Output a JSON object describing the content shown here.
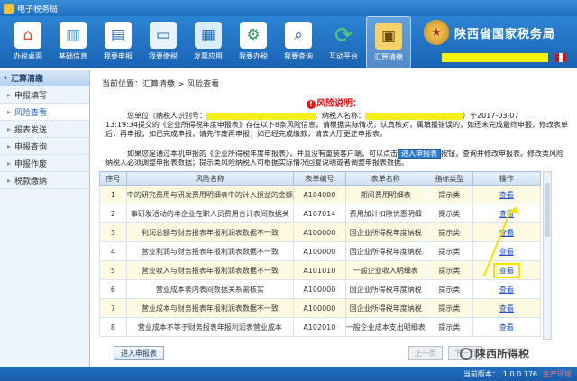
{
  "window": {
    "title": "电子税务局"
  },
  "toolbar": {
    "items": [
      {
        "label": "办税桌面",
        "icon": "home-icon",
        "color": "#e84a2a"
      },
      {
        "label": "基础信息",
        "icon": "chart-icon",
        "color": "#3aa0e8"
      },
      {
        "label": "我要申报",
        "icon": "form-icon",
        "color": "#ffffff"
      },
      {
        "label": "我要缴税",
        "icon": "tax-card-icon",
        "color": "#6bc0f0"
      },
      {
        "label": "发票应用",
        "icon": "invoice-icon",
        "color": "#59b7ea"
      },
      {
        "label": "我要办税",
        "icon": "gear-icon",
        "color": "#2aa05a"
      },
      {
        "label": "我要查询",
        "icon": "search-icon",
        "color": "#ffffff"
      },
      {
        "label": "互动平台",
        "icon": "refresh-icon",
        "color": "#4fd16a"
      },
      {
        "label": "汇算清缴",
        "icon": "settlement-icon",
        "color": "#f6d36a",
        "active": true
      }
    ],
    "brand": "陕西省国家税务局"
  },
  "sidebar": {
    "header": "汇算清缴",
    "items": [
      {
        "label": "申报填写",
        "active": false
      },
      {
        "label": "风险查看",
        "active": true
      },
      {
        "label": "报表发送",
        "active": false
      },
      {
        "label": "申报查询",
        "active": false
      },
      {
        "label": "申报作废",
        "active": false
      },
      {
        "label": "税款缴纳",
        "active": false
      }
    ]
  },
  "main": {
    "breadcrumb": "当前位置：汇算清缴 > 风险查看",
    "notice_title": "风险说明：",
    "para1_a": "您单位（纳税人识别号：",
    "para1_b": "，纳税人名称：",
    "para1_c": "）于2017-03-07",
    "para1_d": "13:19:34提交的《企业所得税年度申报表》存在以下8条风险信息，请根据实际情况，认真核对，属填报错误的，如还未完成最终申报，修改表单后，再申报；如已完成申报，请先作废再申报；如已经完成缴款，请去大厅更正申报表。",
    "para2_a": "如果您是通过本机申报的《企业所得税年度申报表》，并且没有重装客户端，可以点击",
    "para2_btn": "进入申报表",
    "para2_b": "按钮，查询并修改申报表。修改类风险纳税人必须调整申报表数据；提示类风险纳税人可根据实际情况回复说明或者调整申报表数据。",
    "columns": [
      "序号",
      "风险名称",
      "表单编号",
      "表单名称",
      "指标类型",
      "操作"
    ],
    "rows": [
      {
        "no": "1",
        "name": "中的研究费用与研发费用明细表中的计入损益的金额",
        "code": "A104000",
        "form": "期间费用明细表",
        "type": "提示类",
        "op": "查看"
      },
      {
        "no": "2",
        "name": "事研发活动的本企业在职人员费用合计表间数据关",
        "code": "A107014",
        "form": "费用加计扣除优惠明细",
        "type": "提示类",
        "op": "查看"
      },
      {
        "no": "3",
        "name": "利润总额与财务报表年报利润表数据不一致",
        "code": "A100000",
        "form": "国企业所得税年度纳税",
        "type": "提示类",
        "op": "查看"
      },
      {
        "no": "4",
        "name": "营业利润与财务报表年报利润表数据不一致",
        "code": "A100000",
        "form": "国企业所得税年度纳税",
        "type": "提示类",
        "op": "查看"
      },
      {
        "no": "5",
        "name": "营业收入与财务报表年报利润表数据不一致",
        "code": "A101010",
        "form": "一般企业收入明细表",
        "type": "提示类",
        "op": "查看",
        "highlight": true
      },
      {
        "no": "6",
        "name": "营业成本表内表间数据关系需核实",
        "code": "A100000",
        "form": "国企业所得税年度纳税",
        "type": "提示类",
        "op": "查看"
      },
      {
        "no": "7",
        "name": "营业成本与财务报表年报利润表数据不一致",
        "code": "A100000",
        "form": "国企业所得税年度纳税",
        "type": "提示类",
        "op": "查看"
      },
      {
        "no": "8",
        "name": "营业成本不等于财务报表年报利润表营业成本",
        "code": "A102010",
        "form": "一般企业成本支出明细表",
        "type": "提示类",
        "op": "查看"
      }
    ],
    "enter_button": "进入申报表",
    "prev_button": "上一页",
    "next_button": "下一页"
  },
  "status": {
    "version_label": "当前版本：",
    "version": "1.0.0.176",
    "env": "生产环境"
  },
  "watermark": "陕西所得税"
}
